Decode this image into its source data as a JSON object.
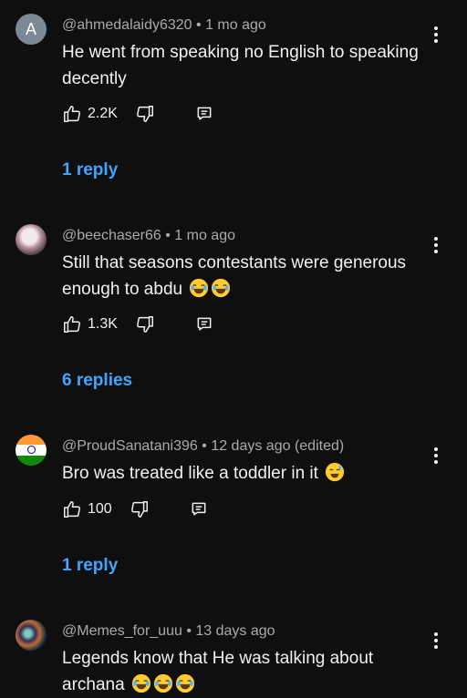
{
  "comments": [
    {
      "avatar_letter": "A",
      "author": "@ahmedalaidy6320",
      "sep": "•",
      "time": "1 mo ago",
      "text": "He went from speaking no English to speaking decently",
      "emojis": [],
      "likes": "2.2K",
      "replies": "1 reply"
    },
    {
      "author": "@beechaser66",
      "sep": "•",
      "time": "1 mo ago",
      "text": "Still that seasons contestants were generous enough to abdu",
      "emojis": [
        "laugh",
        "laugh"
      ],
      "likes": "1.3K",
      "replies": "6 replies"
    },
    {
      "author": "@ProudSanatani396",
      "sep": "•",
      "time": "12 days ago (edited)",
      "text": "Bro was treated like a toddler in it",
      "emojis": [
        "sweat-smile"
      ],
      "likes": "100",
      "replies": "1 reply"
    },
    {
      "author": "@Memes_for_uuu",
      "sep": "•",
      "time": "13 days ago",
      "text": "Legends know that He was talking about archana",
      "emojis": [
        "laugh",
        "laugh",
        "laugh"
      ]
    }
  ],
  "icons": {
    "like": "thumb-up-icon",
    "dislike": "thumb-down-icon",
    "reply": "reply-icon",
    "more": "more-vertical-icon"
  },
  "colors": {
    "background": "#0f0f0f",
    "link": "#3ea6ff",
    "muted": "#aaaaaa",
    "text": "#f1f1f1"
  }
}
